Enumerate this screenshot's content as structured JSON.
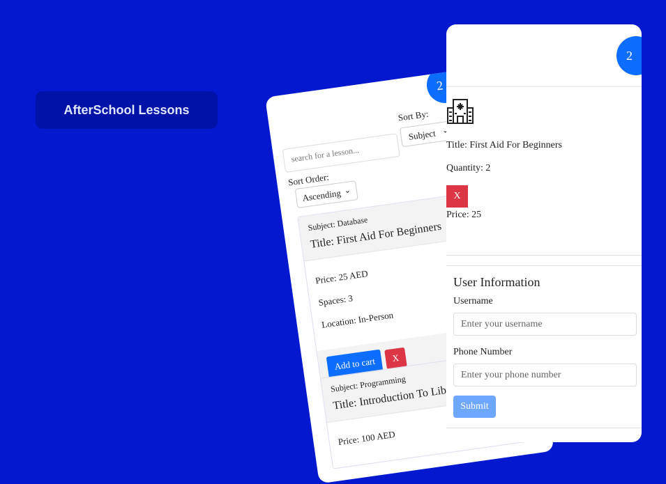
{
  "app": {
    "title": "AfterSchool Lessons"
  },
  "catalog": {
    "cart_count": "2",
    "sort_by": {
      "label": "Sort By:",
      "value": "Subject"
    },
    "search": {
      "placeholder": "search for a lesson..."
    },
    "sort_order": {
      "label": "Sort Order:",
      "value": "Ascending"
    },
    "lessons": [
      {
        "subject": "Subject: Database",
        "title": "Title: First Aid For Beginners",
        "price": "Price: 25 AED",
        "spaces": "Spaces: 3",
        "location": "Location: In-Person",
        "add_label": "Add to cart",
        "remove_label": "X"
      },
      {
        "subject": "Subject: Programming",
        "title": "Title: Introduction To Library Practices",
        "price": "Price: 100 AED"
      }
    ]
  },
  "cart": {
    "count": "2",
    "item": {
      "icon": "hospital-icon",
      "title": "Title: First Aid For Beginners",
      "quantity": "Quantity: 2",
      "remove_label": "X",
      "price": "Price: 25"
    }
  },
  "user_info": {
    "heading": "User Information",
    "username_label": "Username",
    "username_placeholder": "Enter your username",
    "phone_label": "Phone Number",
    "phone_placeholder": "Enter your phone number",
    "submit_label": "Submit"
  },
  "colors": {
    "background": "#0418cf",
    "primary": "#0d6efd",
    "danger": "#dc3545",
    "submit": "#6ea8fe"
  }
}
